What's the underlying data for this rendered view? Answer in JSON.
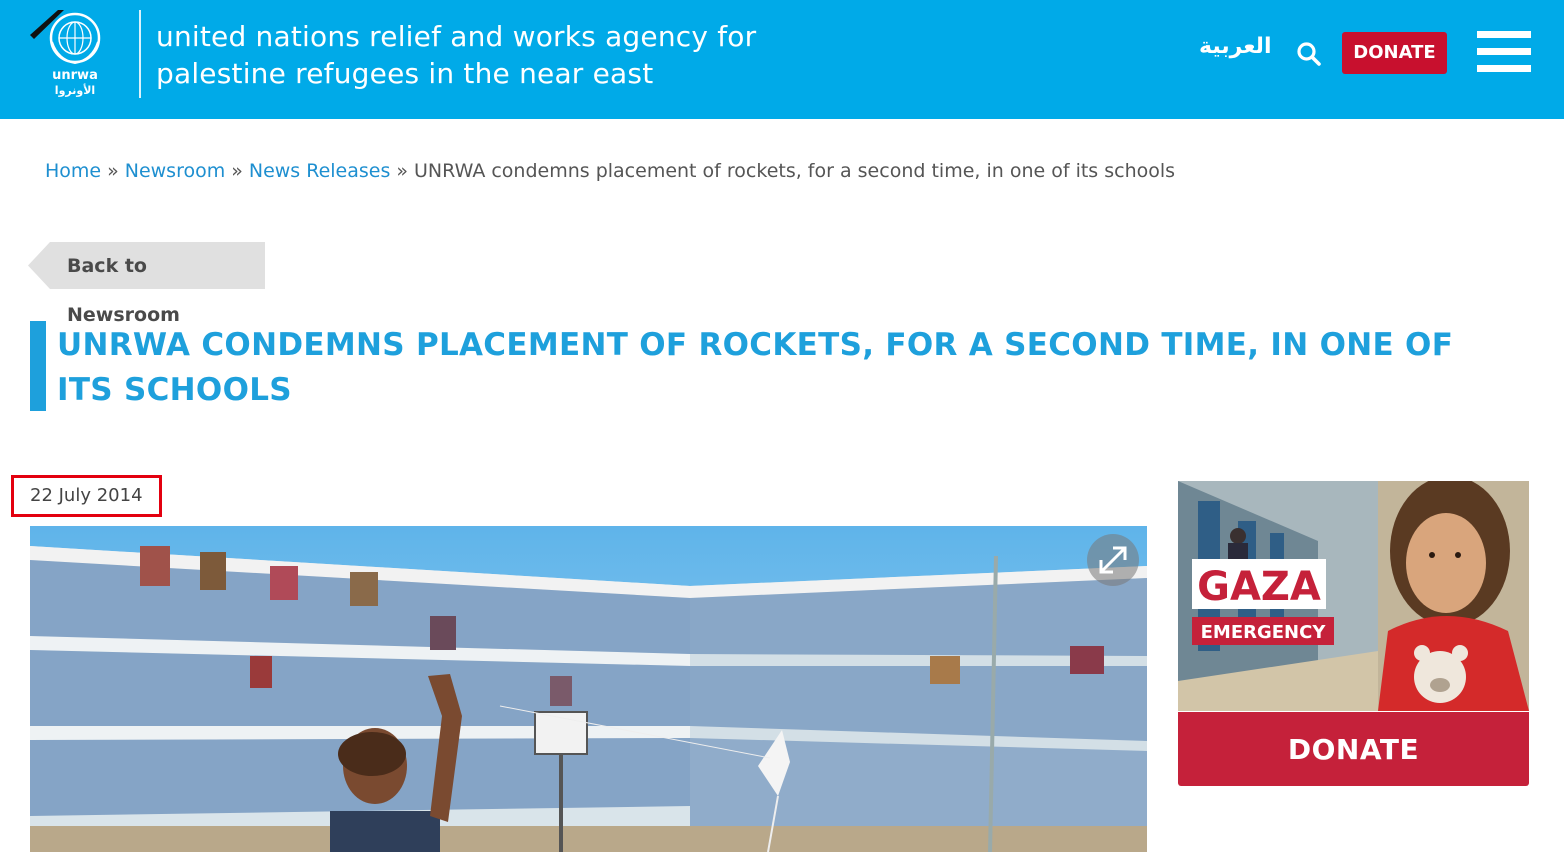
{
  "header": {
    "logo_text_latin": "unrwa",
    "logo_text_arabic": "الأونروا",
    "agency_line1": "united nations relief and works agency for",
    "agency_line2": "palestine refugees in the near east",
    "arabic_link": "العربية",
    "donate_label": "DONATE",
    "search_icon": "search-icon",
    "menu_icon": "hamburger-menu-icon",
    "background_color": "#00aae8",
    "donate_color": "#c8102e"
  },
  "breadcrumb": {
    "items": [
      {
        "label": "Home"
      },
      {
        "label": "Newsroom"
      },
      {
        "label": "News Releases"
      }
    ],
    "separator": "»",
    "current": "UNRWA condemns placement of rockets, for a second time, in one of its schools"
  },
  "back_button": {
    "label": "Back to Newsroom"
  },
  "article": {
    "title": "UNRWA condemns placement of rockets, for a second time, in one of its schools",
    "date": "22 July 2014",
    "title_color": "#1ea0dc",
    "expand_icon": "expand-icon"
  },
  "sidebar": {
    "promo_title": "GAZA",
    "promo_subtitle": "EMERGENCY",
    "donate_label": "DONATE",
    "donate_color": "#c5213a"
  }
}
